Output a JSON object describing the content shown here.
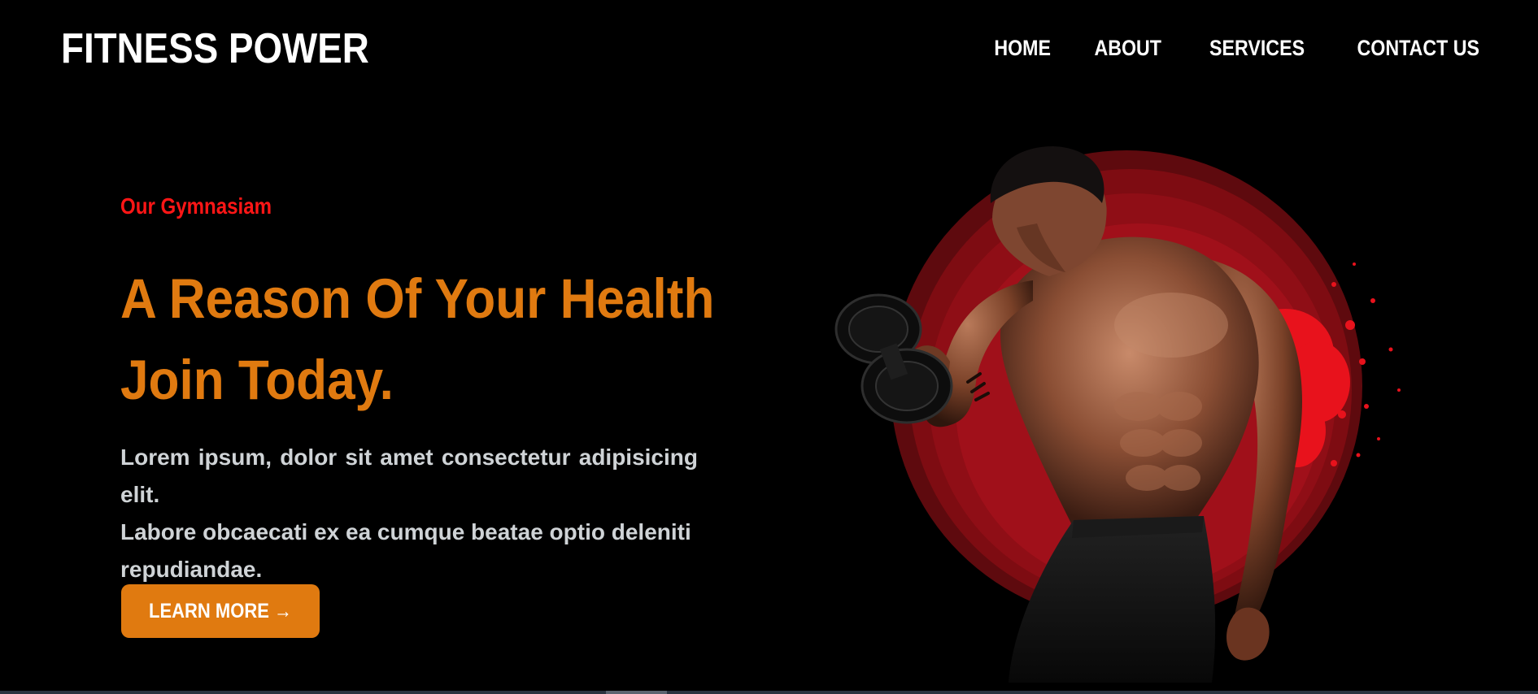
{
  "header": {
    "logo": "FITNESS POWER",
    "nav": [
      {
        "label": "HOME"
      },
      {
        "label": "ABOUT"
      },
      {
        "label": "SERVICES"
      },
      {
        "label": "CONTACT US"
      }
    ]
  },
  "hero": {
    "eyebrow": "Our Gymnasiam",
    "headline_line1": "A Reason Of Your Health",
    "headline_line2": "Join Today.",
    "description_line1": "Lorem ipsum, dolor sit amet consectetur adipisicing elit.",
    "description_line2": "Labore obcaecati ex ea cumque beatae optio deleniti",
    "description_line3": "repudiandae.",
    "cta_label": "LEARN MORE →",
    "image": "bodybuilder-with-dumbbell-illustration"
  },
  "colors": {
    "background": "#000000",
    "accent_orange": "#e07a10",
    "accent_red": "#ff1616",
    "text_light": "#cfd3d6",
    "circle_red": "#a0101a"
  }
}
